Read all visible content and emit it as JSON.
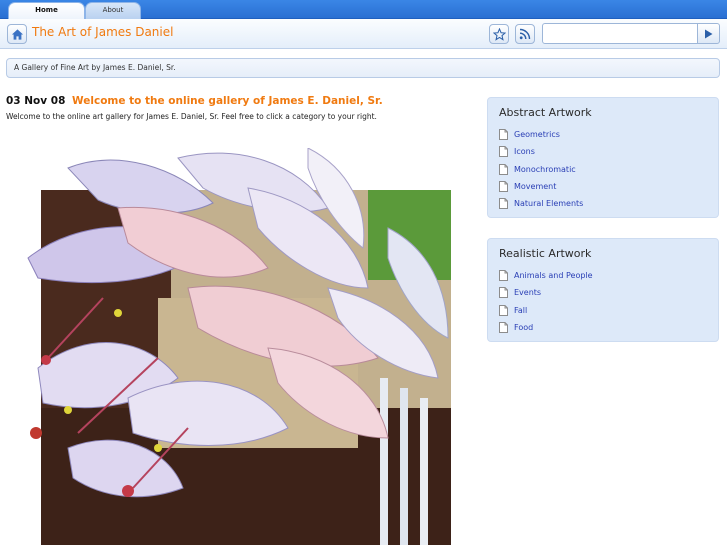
{
  "tabs": [
    {
      "label": "Home",
      "active": true
    },
    {
      "label": "About",
      "active": false
    }
  ],
  "header": {
    "home_icon": "home-icon",
    "title": "The Art of James Daniel",
    "bookmark_icon": "star-icon",
    "feed_icon": "rss-icon",
    "search": {
      "value": "",
      "placeholder": ""
    },
    "search_go_icon": "play-arrow-icon"
  },
  "tagline": "A Gallery of Fine Art by James E. Daniel, Sr.",
  "post": {
    "date": "03 Nov 08",
    "title": "Welcome to the online gallery of James E. Daniel, Sr.",
    "body": "Welcome to the online art gallery for James E. Daniel, Sr.  Feel free to click a category to your right."
  },
  "sidebar": {
    "abstract": {
      "title": "Abstract Artwork",
      "items": [
        "Geometrics",
        "Icons",
        "Monochromatic",
        "Movement",
        "Natural Elements"
      ]
    },
    "realistic": {
      "title": "Realistic Artwork",
      "items": [
        "Animals and People",
        "Events",
        "Fall",
        "Food"
      ]
    }
  },
  "colors": {
    "accent_orange": "#f07a10",
    "tab_bar_blue": "#2a6fd2",
    "panel_bg": "#dde9f9",
    "link_blue": "#2a3fb5"
  }
}
